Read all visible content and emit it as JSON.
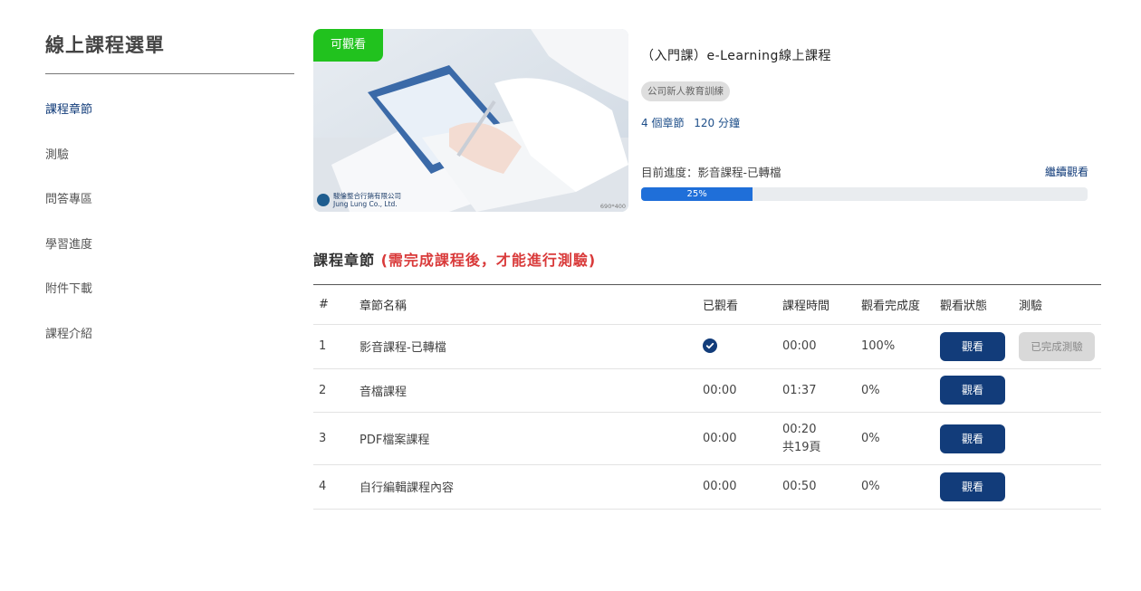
{
  "sidebar": {
    "title": "線上課程選單",
    "items": [
      {
        "label": "課程章節"
      },
      {
        "label": "測驗"
      },
      {
        "label": "問答專區"
      },
      {
        "label": "學習進度"
      },
      {
        "label": "附件下載"
      },
      {
        "label": "課程介紹"
      }
    ]
  },
  "course": {
    "badge": "可觀看",
    "brand_line1": "駿倫整合行銷有限公司",
    "brand_line2": "Jung Lung Co., Ltd.",
    "image_size": "690*400",
    "title": "（入門課）e-Learning線上課程",
    "tag": "公司新人教育訓練",
    "chapters": "4 個章節",
    "duration": "120 分鐘",
    "progress_label": "目前進度：影音課程-已轉檔",
    "continue_label": "繼續觀看",
    "progress": 25,
    "progress_text": "25%"
  },
  "chapters": {
    "title": "課程章節",
    "note": "(需完成課程後，才能進行測驗)",
    "headers": {
      "num": "#",
      "name": "章節名稱",
      "watched": "已觀看",
      "time": "課程時間",
      "pct": "觀看完成度",
      "status": "觀看狀態",
      "quiz": "測驗"
    },
    "rows": [
      {
        "num": "1",
        "name": "影音課程-已轉檔",
        "watched": "",
        "time": "00:00",
        "extra": "",
        "pct": "100%",
        "button": "觀看",
        "quiz": "已完成測驗"
      },
      {
        "num": "2",
        "name": "音檔課程",
        "watched": "00:00",
        "time": "01:37",
        "extra": "",
        "pct": "0%",
        "button": "觀看",
        "quiz": ""
      },
      {
        "num": "3",
        "name": "PDF檔案課程",
        "watched": "00:00",
        "time": "00:20",
        "extra": "共19頁",
        "pct": "0%",
        "button": "觀看",
        "quiz": ""
      },
      {
        "num": "4",
        "name": "自行編輯課程內容",
        "watched": "00:00",
        "time": "00:50",
        "extra": "",
        "pct": "0%",
        "button": "觀看",
        "quiz": ""
      }
    ]
  },
  "colors": {
    "accent": "#123c7a",
    "badge_green": "#21c21e",
    "note_red": "#d93a3a",
    "progress_blue": "#1f6fd9"
  }
}
